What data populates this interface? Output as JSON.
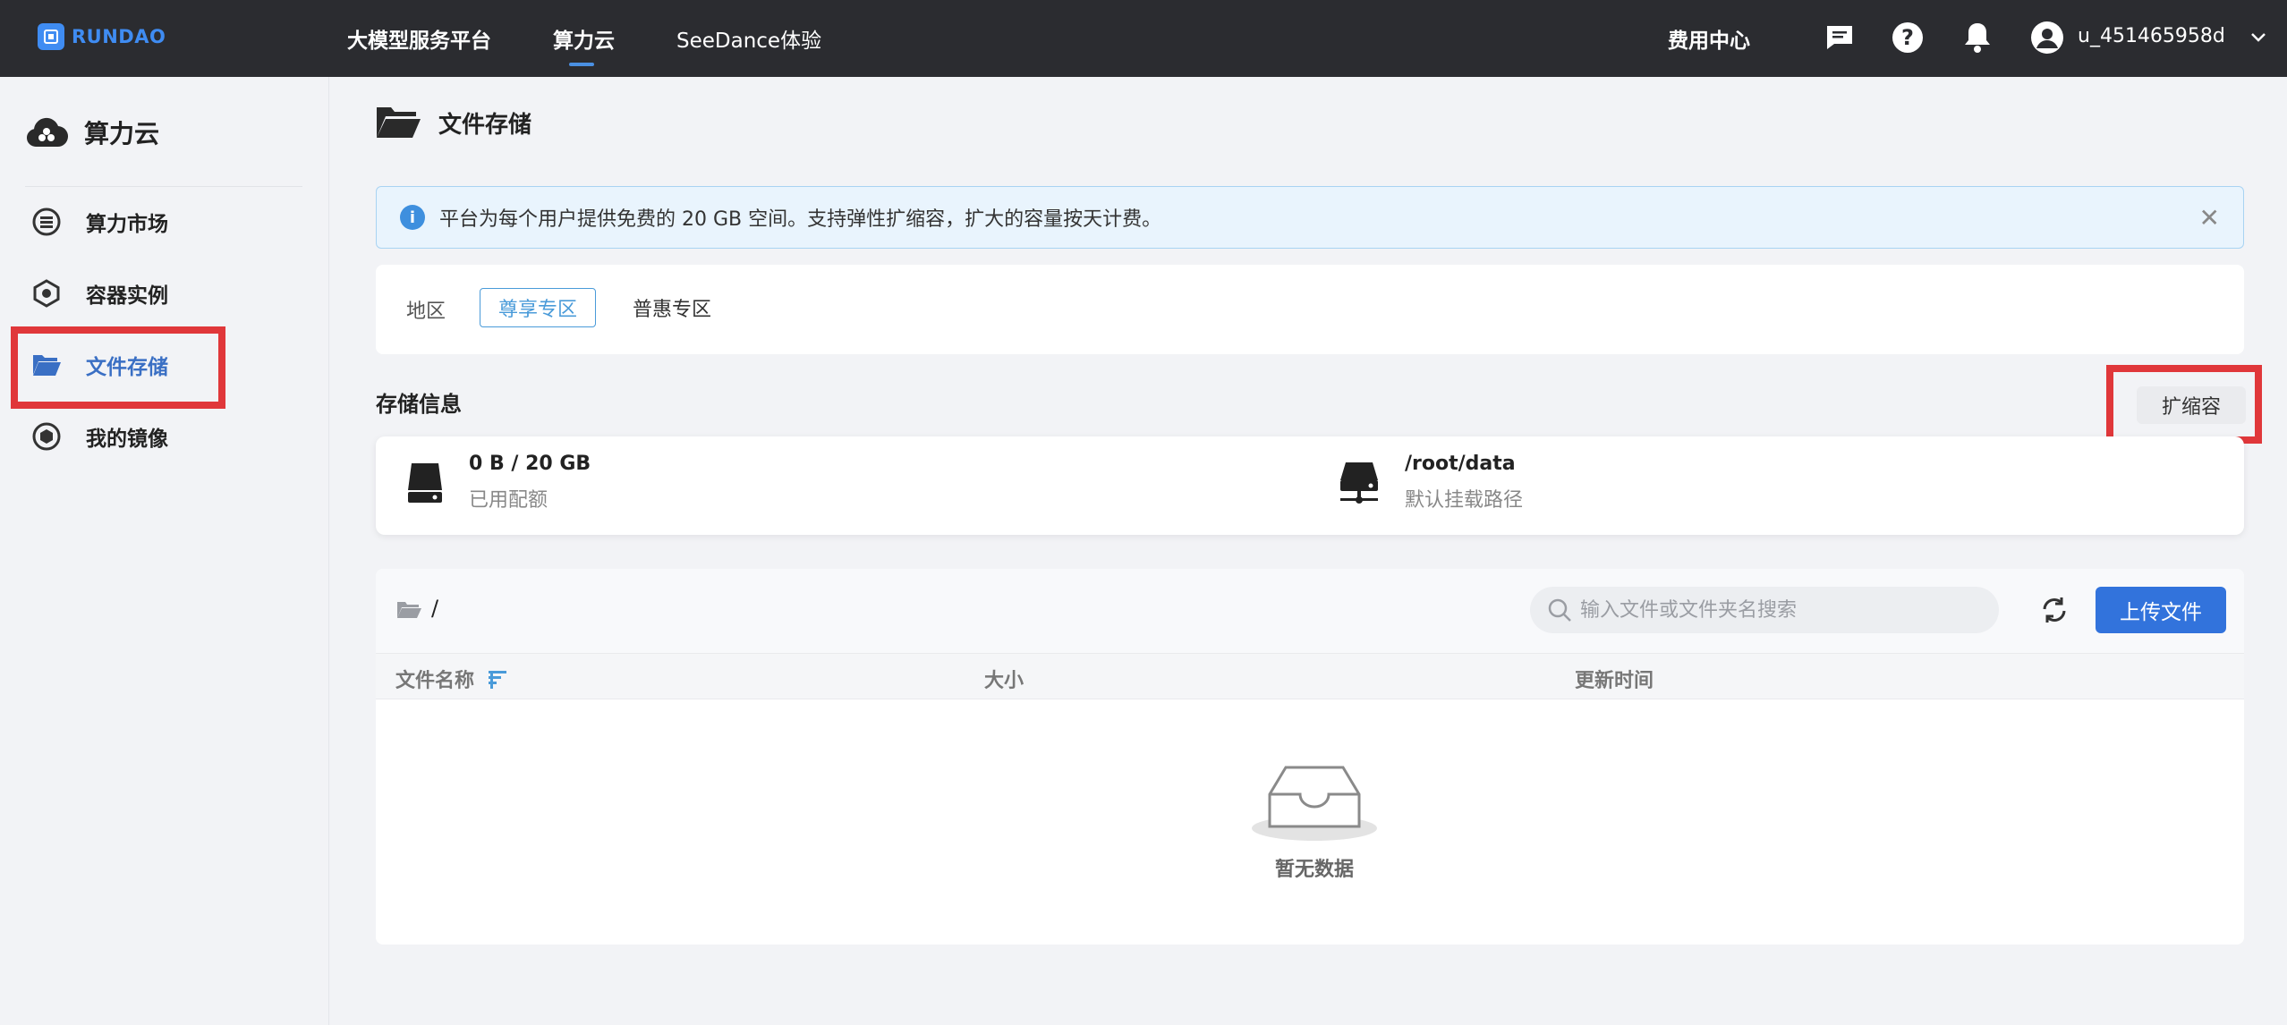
{
  "brand": {
    "name": "RUNDAO"
  },
  "topnav": {
    "items": [
      {
        "label": "大模型服务平台"
      },
      {
        "label": "算力云"
      },
      {
        "label": "SeeDance体验"
      }
    ],
    "billing": "费用中心",
    "username": "u_451465958d",
    "icons": [
      "message-icon",
      "help-icon",
      "bell-icon",
      "user-avatar-icon",
      "chevron-down-icon"
    ]
  },
  "sidebar": {
    "title": "算力云",
    "items": [
      {
        "label": "算力市场"
      },
      {
        "label": "容器实例"
      },
      {
        "label": "文件存储"
      },
      {
        "label": "我的镜像"
      }
    ]
  },
  "page": {
    "title": "文件存储",
    "alert": "平台为每个用户提供免费的 20 GB 空间。支持弹性扩缩容，扩大的容量按天计费。",
    "region": {
      "label": "地区",
      "tabs": [
        "尊享专区",
        "普惠专区"
      ]
    },
    "storage": {
      "section_label": "存储信息",
      "expand_label": "扩缩容",
      "quota_value": "0 B / 20 GB",
      "quota_label": "已用配额",
      "mount_value": "/root/data",
      "mount_label": "默认挂载路径"
    },
    "files": {
      "path": "/",
      "search_placeholder": "输入文件或文件夹名搜索",
      "upload_label": "上传文件",
      "columns": [
        "文件名称",
        "大小",
        "更新时间"
      ],
      "empty_text": "暂无数据"
    }
  },
  "colors": {
    "topnav_bg": "#2b2c30",
    "accent": "#3273dc",
    "highlight": "#e0373a",
    "alert_bg": "#e9f4fd"
  }
}
